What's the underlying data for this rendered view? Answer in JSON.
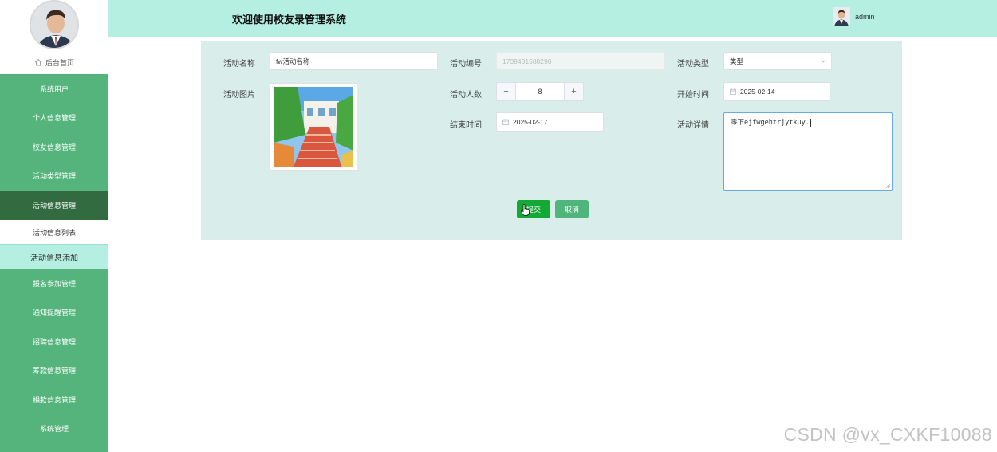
{
  "header": {
    "title": "欢迎使用校友录管理系统",
    "username": "admin"
  },
  "sidebar": {
    "home_label": "后台首页",
    "menu": [
      {
        "label": "系统用户"
      },
      {
        "label": "个人信息管理"
      },
      {
        "label": "校友信息管理"
      },
      {
        "label": "活动类型管理"
      },
      {
        "label": "活动信息管理"
      }
    ],
    "submenu": [
      {
        "label": "活动信息列表"
      },
      {
        "label": "活动信息添加"
      }
    ],
    "menu_after": [
      {
        "label": "报名参加管理"
      },
      {
        "label": "通知提醒管理"
      },
      {
        "label": "招聘信息管理"
      },
      {
        "label": "筹款信息管理"
      },
      {
        "label": "捐款信息管理"
      },
      {
        "label": "系统管理"
      }
    ]
  },
  "form": {
    "name_label": "活动名称",
    "name_value": "fw活动名称",
    "code_label": "活动编号",
    "code_value": "1739431588290",
    "type_label": "活动类型",
    "type_value": "类型",
    "image_label": "活动图片",
    "count_label": "活动人数",
    "count_value": "8",
    "count_minus": "−",
    "count_plus": "+",
    "start_label": "开始时间",
    "start_value": "2025-02-14",
    "end_label": "结束时间",
    "end_value": "2025-02-17",
    "detail_label": "活动详情",
    "detail_value": "零下ejfwgehtrjytkuy.",
    "submit_label": "提交",
    "cancel_label": "取消"
  },
  "watermark": "CSDN @vx_CXKF10088",
  "icons": {
    "home": "home-icon",
    "calendar": "calendar-icon",
    "chevron": "chevron-down-icon",
    "cursor": "hand-cursor-icon"
  },
  "colors": {
    "header_bg": "#b4efe1",
    "sidebar_bg": "#54b47c",
    "sidebar_active": "#336b41",
    "panel_bg": "#d9eeea",
    "submit_bg": "#12a935",
    "cancel_bg": "#4fb57a"
  }
}
